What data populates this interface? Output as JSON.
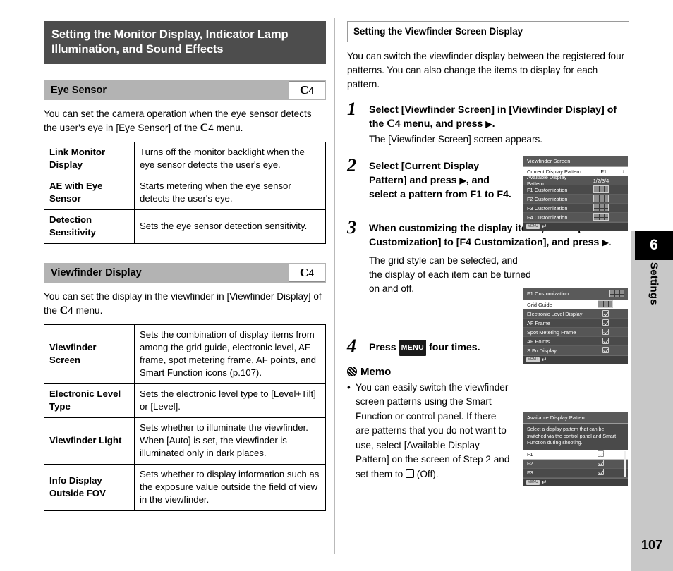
{
  "page": {
    "number": "107",
    "chapter_number": "6",
    "chapter_label": "Settings"
  },
  "left": {
    "chapter_title": "Setting the Monitor Display, Indicator Lamp Illumination, and Sound Effects",
    "sections": [
      {
        "name": "Eye Sensor",
        "menu_badge_letter": "C",
        "menu_badge_number": "4",
        "intro_part1": "You can set the camera operation when the eye sensor detects the user's eye in [Eye Sensor] of the ",
        "intro_c": "C",
        "intro_part2": "4 menu.",
        "rows": [
          {
            "key": "Link Monitor Display",
            "desc": "Turns off the monitor backlight when the eye sensor detects the user's eye."
          },
          {
            "key": "AE with Eye Sensor",
            "desc": "Starts metering when the eye sensor detects the user's eye."
          },
          {
            "key": "Detection Sensitivity",
            "desc": "Sets the eye sensor detection sensitivity."
          }
        ]
      },
      {
        "name": "Viewfinder Display",
        "menu_badge_letter": "C",
        "menu_badge_number": "4",
        "intro_part1": "You can set the display in the viewfinder in [Viewfinder Display] of the ",
        "intro_c": "C",
        "intro_part2": "4 menu.",
        "rows": [
          {
            "key": "Viewfinder Screen",
            "desc": "Sets the combination of display items from among the grid guide, electronic level, AF frame, spot metering frame, AF points, and Smart Function icons (p.107)."
          },
          {
            "key": "Electronic Level Type",
            "desc": "Sets the electronic level type to [Level+Tilt] or [Level]."
          },
          {
            "key": "Viewfinder Light",
            "desc": "Sets whether to illuminate the viewfinder. When [Auto] is set, the viewfinder is illuminated only in dark places."
          },
          {
            "key": "Info Display Outside FOV",
            "desc": "Sets whether to display information such as the exposure value outside the field of view in the viewfinder."
          }
        ]
      }
    ]
  },
  "right": {
    "boxed_heading": "Setting the Viewfinder Screen Display",
    "intro": "You can switch the viewfinder display between the registered four patterns. You can also change the items to display for each pattern.",
    "steps": [
      {
        "num": "1",
        "lead_part1": "Select [Viewfinder Screen] in [Viewfinder Display] of the ",
        "lead_c": "C",
        "lead_part2": "4 menu, and press ",
        "lead_arrow": "▶",
        "lead_part3": ".",
        "sub": "The [Viewfinder Screen] screen appears."
      },
      {
        "num": "2",
        "lead_part1": "Select [Current Display Pattern] and press ",
        "lead_arrow": "▶",
        "lead_part2": ", and select a pattern from F1 to F4.",
        "sub": ""
      },
      {
        "num": "3",
        "lead_part1": "When customizing the display items, select [F1 Customization] to [F4 Customization], and press ",
        "lead_arrow": "▶",
        "lead_part2": ".",
        "sub": "The grid style can be selected, and the display of each item can be turned on and off."
      },
      {
        "num": "4",
        "lead_part1": "Press ",
        "menu_key": "MENU",
        "lead_part2": " four times.",
        "sub": ""
      }
    ],
    "memo": {
      "title": "Memo",
      "bullet": "•",
      "text_part1": "You can easily switch the viewfinder screen patterns using the Smart Function or control panel. If there are patterns that you do not want to use, select [Available Display Pattern] on the screen of Step 2 and set them to ",
      "text_part2": " (Off)."
    }
  },
  "lcd_screens": {
    "viewfinder_screen": {
      "title": "Viewfinder Screen",
      "rows": [
        {
          "label": "Current Display Pattern",
          "value": "F1",
          "type": "text",
          "selected": true,
          "chevron": "›"
        },
        {
          "label": "Available Display Pattern",
          "value": "1/2/3/4",
          "type": "text",
          "selected": false
        },
        {
          "label": "F1 Customization",
          "value": "",
          "type": "grid",
          "selected": false
        },
        {
          "label": "F2 Customization",
          "value": "",
          "type": "grid",
          "selected": false
        },
        {
          "label": "F3 Customization",
          "value": "",
          "type": "grid",
          "selected": false
        },
        {
          "label": "F4 Customization",
          "value": "",
          "type": "grid",
          "selected": false
        }
      ],
      "footer_key": "MENU"
    },
    "f1_customization": {
      "title": "F1 Customization",
      "rows": [
        {
          "label": "Grid Guide",
          "value": "",
          "type": "grid",
          "selected": true
        },
        {
          "label": "Electronic Level Display",
          "value": "",
          "type": "check",
          "selected": false
        },
        {
          "label": "AF Frame",
          "value": "",
          "type": "check",
          "selected": false
        },
        {
          "label": "Spot Metering Frame",
          "value": "",
          "type": "check",
          "selected": false
        },
        {
          "label": "AF Points",
          "value": "",
          "type": "check",
          "selected": false
        },
        {
          "label": "S.Fn Display",
          "value": "",
          "type": "check",
          "selected": false
        }
      ],
      "footer_key": "MENU"
    },
    "available_display_pattern": {
      "title": "Available Display Pattern",
      "description": "Select a display pattern that can be switched via the control panel and Smart Function during shooting.",
      "rows": [
        {
          "label": "F1",
          "type": "check",
          "selected": true
        },
        {
          "label": "F2",
          "type": "check",
          "selected": false
        },
        {
          "label": "F3",
          "type": "check",
          "selected": false
        }
      ],
      "footer_key": "MENU"
    }
  }
}
